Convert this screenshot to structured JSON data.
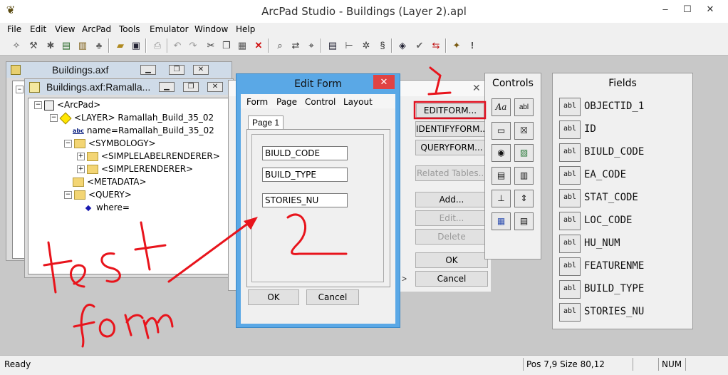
{
  "app": {
    "title": "ArcPad Studio - Buildings (Layer 2).apl"
  },
  "window_controls": {
    "minimize": "–",
    "maximize": "☐",
    "close": "✕"
  },
  "menu": [
    "File",
    "Edit",
    "View",
    "ArcPad",
    "Tools",
    "Emulator",
    "Window",
    "Help"
  ],
  "toolbar": {
    "icons": [
      "layer-tool-icon",
      "wand-icon",
      "star-tool-icon",
      "edit-doc-icon",
      "script-doc-icon",
      "stamp-icon",
      "open-folder-icon",
      "save-icon",
      "print-icon",
      "undo-icon",
      "redo-icon",
      "cut-icon",
      "copy-icon",
      "paste-icon",
      "delete-icon",
      "find-icon",
      "replace-icon",
      "find-next-icon",
      "form-icon",
      "align-icon",
      "settings-icon",
      "script-icon",
      "layers-icon",
      "check-icon",
      "swap-icon",
      "wizard-icon",
      "help-icon"
    ]
  },
  "windows": {
    "buildings_axf": {
      "title": "Buildings.axf"
    },
    "ramallah": {
      "title": "Buildings.axf:Ramalla...",
      "tree": [
        {
          "label": "<ArcPad>"
        },
        {
          "label": "<LAYER> Ramallah_Build_35_02"
        },
        {
          "label": "name=Ramallah_Build_35_02"
        },
        {
          "label": "<SYMBOLOGY>"
        },
        {
          "label": "<SIMPLELABELRENDERER>"
        },
        {
          "label": "<SIMPLERENDERER>"
        },
        {
          "label": "<METADATA>"
        },
        {
          "label": "<QUERY>"
        },
        {
          "label": "where="
        }
      ]
    }
  },
  "edit_form": {
    "title": "Edit Form",
    "menu": [
      "Form",
      "Page",
      "Control",
      "Layout"
    ],
    "tab": "Page 1",
    "fields": [
      "BIULD_CODE",
      "BUILD_TYPE",
      "STORIES_NU"
    ],
    "ok": "OK",
    "cancel": "Cancel"
  },
  "layer_dialog": {
    "buttons": [
      "EDITFORM...",
      "IDENTIFYFORM...",
      "QUERYFORM...",
      "Related Tables...",
      "Add...",
      "Edit...",
      "Delete",
      "OK",
      "Cancel"
    ],
    "scroll_glyph": ">"
  },
  "controls": {
    "title": "Controls"
  },
  "fields_panel": {
    "title": "Fields",
    "icon_label": "abl",
    "items": [
      "OBJECTID_1",
      "ID",
      "BIULD_CODE",
      "EA_CODE",
      "STAT_CODE",
      "LOC_CODE",
      "HU_NUM",
      "FEATURENME",
      "BUILD_TYPE",
      "STORIES_NU"
    ]
  },
  "status": {
    "ready": "Ready",
    "pos": "Pos 7,9 Size 80,12",
    "num": "NUM"
  },
  "colors": {
    "annotation_red": "#e8141c",
    "highlight_box": "#e01020",
    "dialog_bg": "#f0f0f0",
    "editform_frame": "#5aa8e6",
    "close_red": "#e04343"
  }
}
